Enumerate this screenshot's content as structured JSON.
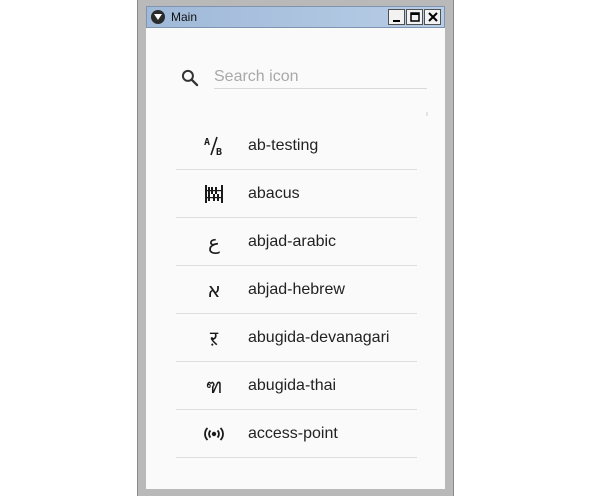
{
  "window": {
    "title": "Main"
  },
  "search": {
    "placeholder": "Search icon",
    "value": ""
  },
  "icons": [
    {
      "name": "ab-testing",
      "icon": "ab-testing-icon"
    },
    {
      "name": "abacus",
      "icon": "abacus-icon"
    },
    {
      "name": "abjad-arabic",
      "icon": "abjad-arabic-icon",
      "glyph": "ع"
    },
    {
      "name": "abjad-hebrew",
      "icon": "abjad-hebrew-icon",
      "glyph": "א"
    },
    {
      "name": "abugida-devanagari",
      "icon": "abugida-devanagari-icon",
      "glyph": "ऱ"
    },
    {
      "name": "abugida-thai",
      "icon": "abugida-thai-icon",
      "glyph": "ฑ"
    },
    {
      "name": "access-point",
      "icon": "access-point-icon"
    }
  ]
}
